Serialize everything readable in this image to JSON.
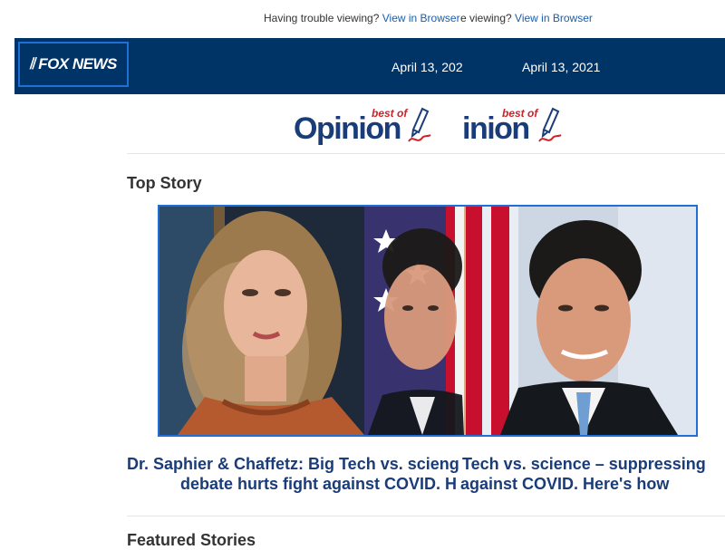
{
  "preheader": {
    "text": "Having trouble viewing?",
    "link": "View in Browser",
    "duplicate_text": "e viewing?",
    "duplicate_link": "View in Browser"
  },
  "header": {
    "logo": "FOX NEWS",
    "date": "April 13, 2021",
    "date_cut": "April 13, 202"
  },
  "opinion_logo": {
    "best_of": "best of",
    "word": "Opinion",
    "word_cut": "inion"
  },
  "top_story": {
    "section_title": "Top Story",
    "headline_line1_a": "Dr. Saphier & Chaffetz: Big Tech vs. scieng",
    "headline_line1_b": "Tech vs. science – suppressing",
    "headline_line2_a": "debate hurts fight against COVID. H",
    "headline_line2_b": "against COVID. Here's how"
  },
  "featured": {
    "section_title": "Featured Stories"
  },
  "colors": {
    "brand_navy": "#003366",
    "link_blue": "#1c5da8",
    "headline_blue": "#1a3c78",
    "opinion_red": "#d0212a"
  }
}
